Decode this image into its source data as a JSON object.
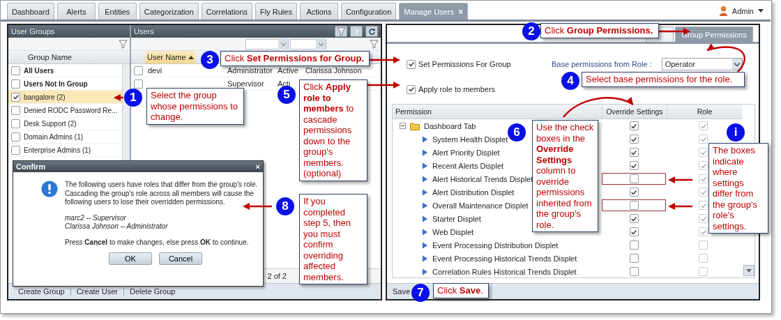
{
  "tabs": [
    {
      "label": "Dashboard",
      "selected": false
    },
    {
      "label": "Alerts",
      "selected": false
    },
    {
      "label": "Entities",
      "selected": false
    },
    {
      "label": "Categorization",
      "selected": false
    },
    {
      "label": "Correlations",
      "selected": false
    },
    {
      "label": "Fly Rules",
      "selected": false
    },
    {
      "label": "Actions",
      "selected": false
    },
    {
      "label": "Configuration",
      "selected": false
    },
    {
      "label": "Manage Users",
      "selected": true,
      "close": "×"
    }
  ],
  "user_menu": {
    "label": "Admin"
  },
  "user_groups": {
    "title": "User Groups",
    "column": "Group Name",
    "rows": [
      {
        "label": "All Users",
        "kind": "builtin",
        "checked": false,
        "selected": false
      },
      {
        "label": "Users Not In Group",
        "kind": "builtin",
        "checked": false,
        "selected": false
      },
      {
        "label": "bangalore (2)",
        "kind": "group",
        "checked": true,
        "selected": true
      },
      {
        "label": "Denied RODC Password Re...",
        "kind": "group",
        "checked": false,
        "selected": false
      },
      {
        "label": "Desk Support (2)",
        "kind": "group",
        "checked": false,
        "selected": false
      },
      {
        "label": "Domain Admins (1)",
        "kind": "group",
        "checked": false,
        "selected": false
      },
      {
        "label": "Enterprise Admins (1)",
        "kind": "group",
        "checked": false,
        "selected": false
      }
    ]
  },
  "users": {
    "title": "Users",
    "column": "User Name",
    "rows": [
      {
        "user_name": "devi",
        "column_2": "Administrator",
        "column_3": "Active",
        "column_4": "Clarissa Johnson",
        "checked": false
      },
      {
        "column_2": "Supervisor",
        "column_3": "Acti",
        "checked": false
      }
    ],
    "pager": "2 of 2"
  },
  "toolbar": [
    "Create Group",
    "Create User",
    "Delete Group"
  ],
  "confirm": {
    "title": "Confirm",
    "close": "×",
    "message": "The following users have roles that differ from the group's role. Cascading the group's role across all members will cause the following users to lose their overridden permissions.",
    "users": [
      "marc2 -- Supervisor",
      "Clarissa Johnson -- Administrator"
    ],
    "footer": "Press **Cancel** to make changes, else press **OK** to continue.",
    "buttons": [
      "OK",
      "Cancel"
    ]
  },
  "detail_tabs": [
    {
      "selected": false
    },
    {
      "label": "Group Permissions",
      "selected": true
    }
  ],
  "set_permissions": {
    "label": "Set Permissions For Group",
    "checked": true
  },
  "apply_role": {
    "label": "Apply role to members",
    "checked": true
  },
  "base_role": {
    "label": "Base permissions from Role :",
    "value": "Operator"
  },
  "permissions": {
    "columns": [
      "Permission",
      "Override Settings",
      "Role"
    ],
    "groups": [
      {
        "label": "Dashboard Tab",
        "expanded": true,
        "override": true,
        "role": true,
        "children": [
          {
            "label": "System Health Displet",
            "override": true,
            "role": true,
            "highlighted": false
          },
          {
            "label": "Alert Priority Displet",
            "override": true,
            "role": true,
            "highlighted": false
          },
          {
            "label": "Recent Alerts Displet",
            "override": true,
            "role": true,
            "highlighted": false
          },
          {
            "label": "Alert Historical Trends Displet",
            "override": false,
            "role": true,
            "highlighted": true
          },
          {
            "label": "Alert Distribution Displet",
            "override": true,
            "role": true,
            "highlighted": false
          },
          {
            "label": "Overall Maintenance Displet",
            "override": false,
            "role": true,
            "highlighted": true
          },
          {
            "label": "Starter Displet",
            "override": true,
            "role": true,
            "highlighted": false
          },
          {
            "label": "Web Displet",
            "override": true,
            "role": true,
            "highlighted": false
          },
          {
            "label": "Event Processing Distribution Displet",
            "override": false,
            "role": false,
            "highlighted": false
          },
          {
            "label": "Event Processing Historical Trends Displet",
            "override": false,
            "role": false,
            "highlighted": false
          },
          {
            "label": "Correlation Rules Historical Trends Displet",
            "override": false,
            "role": false,
            "highlighted": false
          }
        ]
      }
    ]
  },
  "save": "Save",
  "callouts": [
    {
      "number": "1",
      "text": "Select the group whose permissions to change."
    },
    {
      "number": "2",
      "text": "Click **Group Permissions.**"
    },
    {
      "number": "3",
      "text": "Click **Set Permissions for Group.**"
    },
    {
      "number": "4",
      "text": "Select base permissions for the role."
    },
    {
      "number": "5",
      "text": "Click **Apply role to members** to cascade permissions down to the group's members. (optional)"
    },
    {
      "number": "6",
      "text": "Use the check boxes in the **Override Settings** column to override permissions inherited from the group's role."
    },
    {
      "number": "i",
      "text": "The boxes indicate where settings differ from the group's role's settings."
    },
    {
      "number": "7",
      "text": "Click **Save**."
    },
    {
      "number": "8",
      "text": "If you completed step 5, then you must confirm overriding affected members."
    }
  ]
}
